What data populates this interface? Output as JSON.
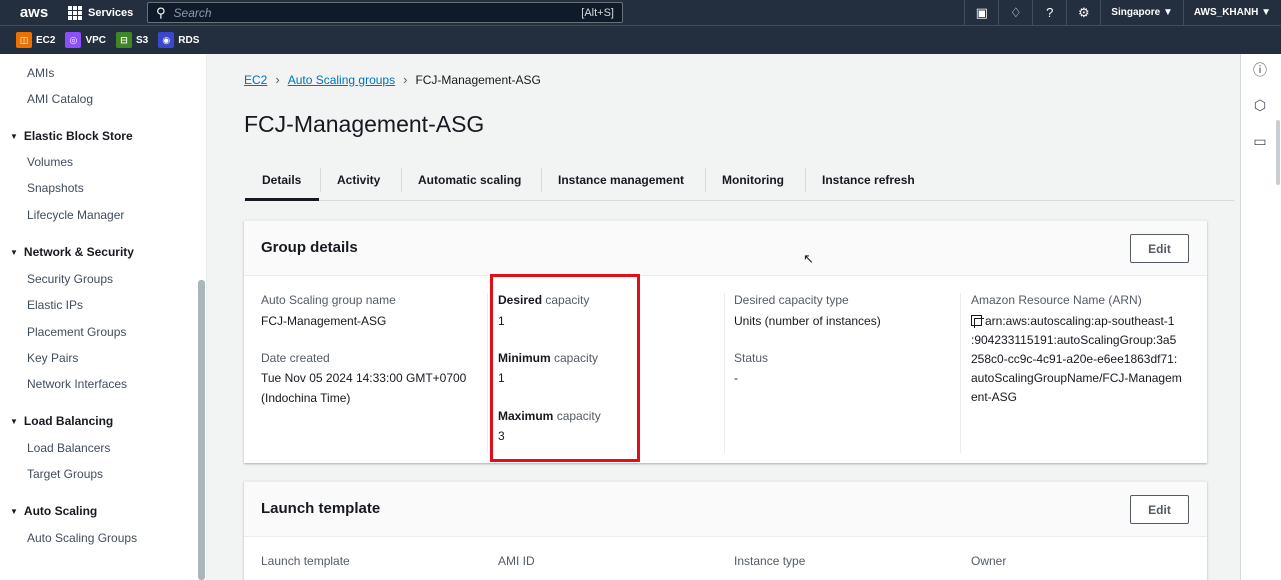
{
  "topbar": {
    "logo": "aws",
    "services_label": "Services",
    "search_placeholder": "Search",
    "search_shortcut": "[Alt+S]",
    "region": "Singapore ▼",
    "account": "AWS_KHANH ▼"
  },
  "favorites": [
    {
      "label": "EC2",
      "color": "#ed7100",
      "icon": "ec2-icon"
    },
    {
      "label": "VPC",
      "color": "#8c4fff",
      "icon": "vpc-icon"
    },
    {
      "label": "S3",
      "color": "#3f8624",
      "icon": "s3-icon"
    },
    {
      "label": "RDS",
      "color": "#3b48cc",
      "icon": "rds-icon"
    }
  ],
  "sidebar": {
    "items": [
      {
        "type": "item",
        "label": "AMIs"
      },
      {
        "type": "item",
        "label": "AMI Catalog"
      },
      {
        "type": "section",
        "label": "Elastic Block Store"
      },
      {
        "type": "item",
        "label": "Volumes"
      },
      {
        "type": "item",
        "label": "Snapshots"
      },
      {
        "type": "item",
        "label": "Lifecycle Manager"
      },
      {
        "type": "section",
        "label": "Network & Security"
      },
      {
        "type": "item",
        "label": "Security Groups"
      },
      {
        "type": "item",
        "label": "Elastic IPs"
      },
      {
        "type": "item",
        "label": "Placement Groups"
      },
      {
        "type": "item",
        "label": "Key Pairs"
      },
      {
        "type": "item",
        "label": "Network Interfaces"
      },
      {
        "type": "section",
        "label": "Load Balancing"
      },
      {
        "type": "item",
        "label": "Load Balancers"
      },
      {
        "type": "item",
        "label": "Target Groups"
      },
      {
        "type": "section",
        "label": "Auto Scaling"
      },
      {
        "type": "item",
        "label": "Auto Scaling Groups"
      }
    ]
  },
  "breadcrumb": {
    "items": [
      "EC2",
      "Auto Scaling groups",
      "FCJ-Management-ASG"
    ]
  },
  "page_title": "FCJ-Management-ASG",
  "tabs": [
    "Details",
    "Activity",
    "Automatic scaling",
    "Instance management",
    "Monitoring",
    "Instance refresh"
  ],
  "active_tab": "Details",
  "group_details": {
    "title": "Group details",
    "edit_label": "Edit",
    "asg_name_label": "Auto Scaling group name",
    "asg_name_value": "FCJ-Management-ASG",
    "date_created_label": "Date created",
    "date_created_value_line1": "Tue Nov 05 2024 14:33:00 GMT+0700",
    "date_created_value_line2": "(Indochina Time)",
    "desired_capacity_label_bold": "Desired",
    "desired_capacity_label_rest": " capacity",
    "desired_capacity_value": "1",
    "minimum_capacity_label_bold": "Minimum",
    "minimum_capacity_label_rest": " capacity",
    "minimum_capacity_value": "1",
    "maximum_capacity_label_bold": "Maximum",
    "maximum_capacity_label_rest": " capacity",
    "maximum_capacity_value": "3",
    "desired_capacity_type_label": "Desired capacity type",
    "desired_capacity_type_value": "Units (number of instances)",
    "status_label": "Status",
    "status_value": "-",
    "arn_label": "Amazon Resource Name (ARN)",
    "arn_line1": "arn:aws:autoscaling:ap-southeast-1",
    "arn_line2": ":904233115191:autoScalingGroup:3a5",
    "arn_line3": "258c0-cc9c-4c91-a20e-e6ee1863df71:",
    "arn_line4": "autoScalingGroupName/FCJ-Managem",
    "arn_line5": "ent-ASG"
  },
  "launch_template": {
    "title": "Launch template",
    "edit_label": "Edit",
    "col1_label": "Launch template",
    "col2_label": "AMI ID",
    "col3_label": "Instance type",
    "col4_label": "Owner"
  },
  "colors": {
    "nav_bg": "#232f3e",
    "link": "#0073bb",
    "highlight": "#e0101b"
  }
}
